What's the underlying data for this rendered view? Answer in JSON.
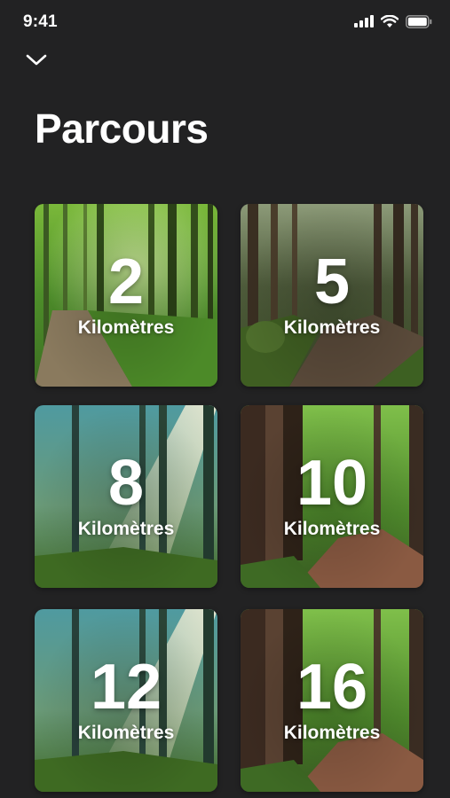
{
  "status_bar": {
    "time": "9:41",
    "icons": [
      "signal-icon",
      "wifi-icon",
      "battery-icon"
    ]
  },
  "header": {
    "dismiss_icon": "chevron-down-icon",
    "title": "Parcours"
  },
  "routes": [
    {
      "distance": "2",
      "unit": "Kilomètres",
      "scene": "green-forest-path"
    },
    {
      "distance": "5",
      "unit": "Kilomètres",
      "scene": "dark-forest-trail"
    },
    {
      "distance": "8",
      "unit": "Kilomètres",
      "scene": "misty-sunbeam-forest"
    },
    {
      "distance": "10",
      "unit": "Kilomètres",
      "scene": "redwood-trail"
    },
    {
      "distance": "12",
      "unit": "Kilomètres",
      "scene": "misty-sunbeam-forest"
    },
    {
      "distance": "16",
      "unit": "Kilomètres",
      "scene": "redwood-trail"
    }
  ],
  "colors": {
    "background": "#222223",
    "text": "#ffffff"
  }
}
